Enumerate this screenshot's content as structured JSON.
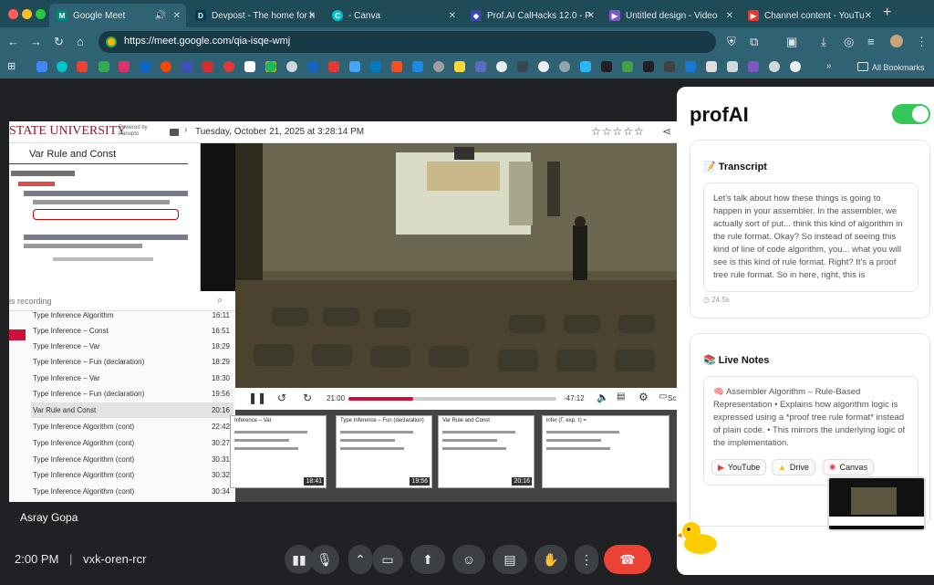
{
  "browser": {
    "tabs": [
      {
        "title": "Google Meet",
        "active": true
      },
      {
        "title": "Devpost - The home for h"
      },
      {
        "title": "- Canva"
      },
      {
        "title": "Prof.AI CalHacks 12.0 - P"
      },
      {
        "title": "Untitled design - Video"
      },
      {
        "title": "Channel content - YouTu"
      }
    ],
    "url": "https://meet.google.com/qia-isqe-wmj",
    "bookmarks_label": "All Bookmarks"
  },
  "panopto": {
    "brand": "STATE UNIVERSITY",
    "powered_by": "Powered by Panopto",
    "date": "Tuesday, October 21, 2025 at 3:28:14 PM",
    "slide_title": "Var Rule and Const",
    "search_placeholder": "is recording",
    "current_time": "21:00",
    "remaining_time": "-47:12",
    "progress": 0.31,
    "screen_label": "Scre",
    "toc": [
      {
        "title": "Type Inference Algorithm",
        "time": "16:11"
      },
      {
        "title": "Type Inference – Const",
        "time": "16:51"
      },
      {
        "title": "Type Inference – Var",
        "time": "18:29"
      },
      {
        "title": "Type Inference – Fun (declaration)",
        "time": "18:29"
      },
      {
        "title": "Type Inference – Var",
        "time": "18:30"
      },
      {
        "title": "Type Inference – Fun (declaration)",
        "time": "19:56"
      },
      {
        "title": "Var Rule and Const",
        "time": "20:16",
        "selected": true
      },
      {
        "title": "Type Inference Algorithm (cont)",
        "time": "22:42"
      },
      {
        "title": "Type Inference Algorithm (cont)",
        "time": "30:27"
      },
      {
        "title": "Type Inference Algorithm (cont)",
        "time": "30:31"
      },
      {
        "title": "Type Inference Algorithm (cont)",
        "time": "30:32"
      },
      {
        "title": "Type Inference Algorithm (cont)",
        "time": "30:34"
      }
    ],
    "thumbs": [
      {
        "title": "Inference – Var",
        "time": "18:41"
      },
      {
        "title": "Type Inference – Fun (declaration)",
        "time": "19:56"
      },
      {
        "title": "Var Rule and Const",
        "time": "20:16"
      },
      {
        "title": "infer (Γ, exp, τ) =",
        "time": ""
      }
    ]
  },
  "meet": {
    "participant_name": "Asray Gopa",
    "time": "2:00 PM",
    "meeting_code": "vxk-oren-rcr"
  },
  "profai": {
    "title": "profAI",
    "transcript_title": "Transcript",
    "transcript_text": "Let's talk about how these things is going to happen in your assembler. In the assembler, we actually sort of put... think this kind of algorithm in the rule format. Okay? So instead of seeing this kind of line of code algorithm, you... what you will see is this kind of rule format. Right? It's a proof tree rule format. So in here, right, this is",
    "transcript_time": "24.5s",
    "notes_title": "Live Notes",
    "notes_text": "Assembler Algorithm – Rule-Based Representation • Explains how algorithm logic is expressed using a *proof tree rule format* instead of plain code. • This mirrors the underlying logic of the implementation.",
    "chips": [
      "YouTube",
      "Drive",
      "Canvas"
    ]
  }
}
